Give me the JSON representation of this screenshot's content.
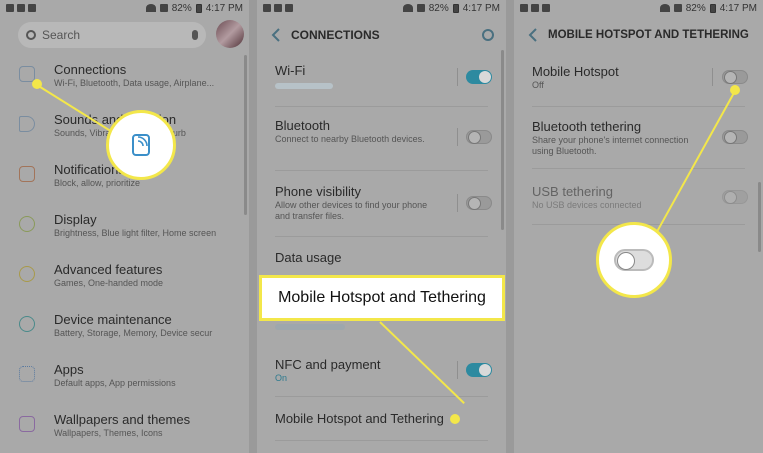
{
  "status": {
    "battery": "82%",
    "time": "4:17 PM"
  },
  "screen1": {
    "search_placeholder": "Search",
    "items": [
      {
        "title": "Connections",
        "subtitle": "Wi-Fi, Bluetooth, Data usage, Airplane...",
        "icon": "connections-icon"
      },
      {
        "title": "Sounds and vibration",
        "subtitle": "Sounds, Vibration, Do not disturb",
        "icon": "volume-icon"
      },
      {
        "title": "Notifications",
        "subtitle": "Block, allow, prioritize",
        "icon": "notifications-icon"
      },
      {
        "title": "Display",
        "subtitle": "Brightness, Blue light filter, Home screen",
        "icon": "display-icon"
      },
      {
        "title": "Advanced features",
        "subtitle": "Games, One-handed mode",
        "icon": "advanced-icon"
      },
      {
        "title": "Device maintenance",
        "subtitle": "Battery, Storage, Memory, Device secur",
        "icon": "maintenance-icon"
      },
      {
        "title": "Apps",
        "subtitle": "Default apps, App permissions",
        "icon": "apps-icon"
      },
      {
        "title": "Wallpapers and themes",
        "subtitle": "Wallpapers, Themes, Icons",
        "icon": "wallpaper-icon"
      }
    ]
  },
  "screen2": {
    "header": "CONNECTIONS",
    "rows": [
      {
        "title": "Wi-Fi",
        "subtitle": "",
        "toggle": "on"
      },
      {
        "title": "Bluetooth",
        "subtitle": "Connect to nearby Bluetooth devices.",
        "toggle": "off"
      },
      {
        "title": "Phone visibility",
        "subtitle": "Allow other devices to find your phone and transfer files.",
        "toggle": "off"
      },
      {
        "title": "Data usage",
        "subtitle": "",
        "toggle": null
      },
      {
        "title": "NFC and payment",
        "subtitle": "On",
        "toggle": "on"
      },
      {
        "title": "Mobile Hotspot and Tethering",
        "subtitle": "",
        "toggle": null
      }
    ],
    "callout": "Mobile Hotspot and Tethering"
  },
  "screen3": {
    "header": "MOBILE HOTSPOT AND TETHERING",
    "rows": [
      {
        "title": "Mobile Hotspot",
        "subtitle": "Off",
        "toggle": "off"
      },
      {
        "title": "Bluetooth tethering",
        "subtitle": "Share your phone's internet connection using Bluetooth.",
        "toggle": "off"
      },
      {
        "title": "USB tethering",
        "subtitle": "No USB devices connected",
        "toggle": "off",
        "disabled": true
      }
    ]
  },
  "colors": {
    "highlight": "#f3e74a",
    "accent": "#2d8aa0"
  }
}
